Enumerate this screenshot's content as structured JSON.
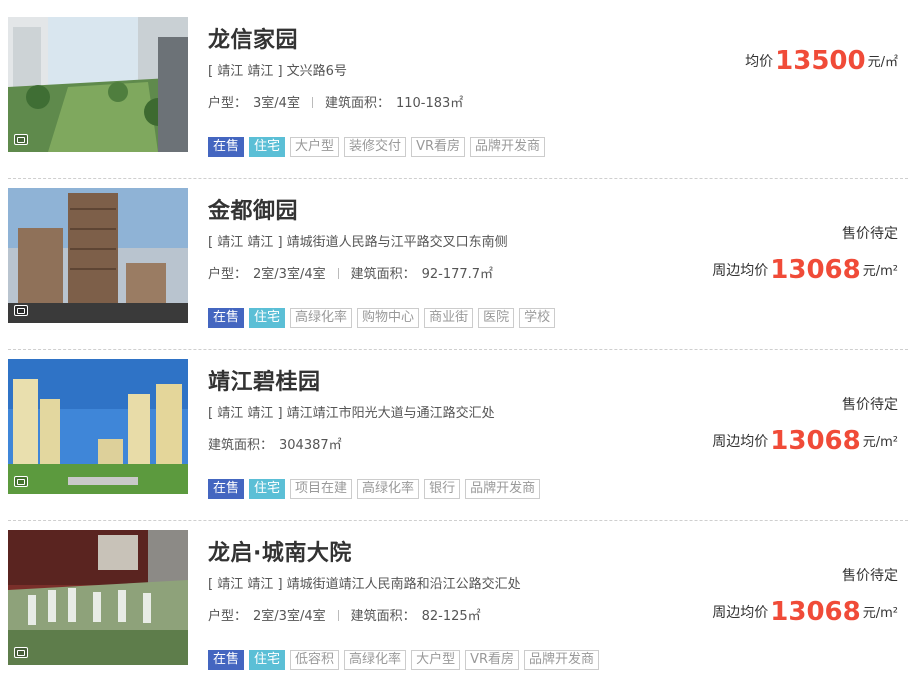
{
  "listings": [
    {
      "title": "龙信家园",
      "address": "[ 靖江 靖江 ] 文兴路6号",
      "layout_label": "户型：",
      "layout_value": "3室/4室",
      "area_label": "建筑面积：",
      "area_value": "110-183㎡",
      "price_label": "均价",
      "price_value": "13500",
      "price_unit": "元/㎡",
      "tags": [
        "在售",
        "住宅",
        "大户型",
        "装修交付",
        "VR看房",
        "品牌开发商"
      ],
      "image_icon": "photo-gallery-icon"
    },
    {
      "title": "金都御园",
      "address": "[ 靖江 靖江 ] 靖城街道人民路与江平路交叉口东南侧",
      "layout_label": "户型：",
      "layout_value": "2室/3室/4室",
      "area_label": "建筑面积：",
      "area_value": "92-177.7㎡",
      "price_status": "售价待定",
      "near_label": "周边均价",
      "near_value": "13068",
      "near_unit": "元/m²",
      "tags": [
        "在售",
        "住宅",
        "高绿化率",
        "购物中心",
        "商业街",
        "医院",
        "学校"
      ],
      "image_icon": "photo-gallery-icon"
    },
    {
      "title": "靖江碧桂园",
      "address": "[ 靖江 靖江 ] 靖江靖江市阳光大道与通江路交汇处",
      "area_label": "建筑面积：",
      "area_value": "304387㎡",
      "price_status": "售价待定",
      "near_label": "周边均价",
      "near_value": "13068",
      "near_unit": "元/m²",
      "tags": [
        "在售",
        "住宅",
        "项目在建",
        "高绿化率",
        "银行",
        "品牌开发商"
      ],
      "image_icon": "photo-gallery-icon"
    },
    {
      "title": "龙启·城南大院",
      "address": "[ 靖江 靖江 ] 靖城街道靖江人民南路和沿江公路交汇处",
      "layout_label": "户型：",
      "layout_value": "2室/3室/4室",
      "area_label": "建筑面积：",
      "area_value": "82-125㎡",
      "price_status": "售价待定",
      "near_label": "周边均价",
      "near_value": "13068",
      "near_unit": "元/m²",
      "tags": [
        "在售",
        "住宅",
        "低容积",
        "高绿化率",
        "大户型",
        "VR看房",
        "品牌开发商"
      ],
      "image_icon": "photo-gallery-icon"
    }
  ],
  "colors": {
    "price": "#f04b38",
    "tag_sale": "#4466c0",
    "tag_residential": "#5bbfd6"
  }
}
